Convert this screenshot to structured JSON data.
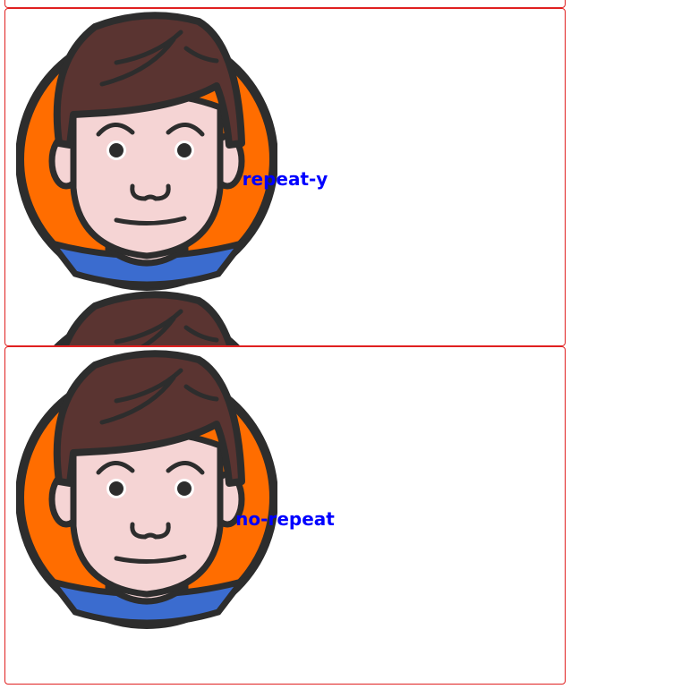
{
  "boxes": [
    {
      "id": "repeat-y",
      "label": "repeat-y",
      "repeat": "repeat-y"
    },
    {
      "id": "no-repeat",
      "label": "no-repeat",
      "repeat": "no-repeat"
    }
  ],
  "colors": {
    "border": "#e02020",
    "label": "#0000ff",
    "avatar_bg": "#ff6d00",
    "hair": "#5a3431",
    "skin": "#f5d4d4",
    "shirt": "#3b6ccf",
    "outline": "#2d2d2d"
  },
  "icons": {
    "avatar": "man-avatar-icon"
  }
}
